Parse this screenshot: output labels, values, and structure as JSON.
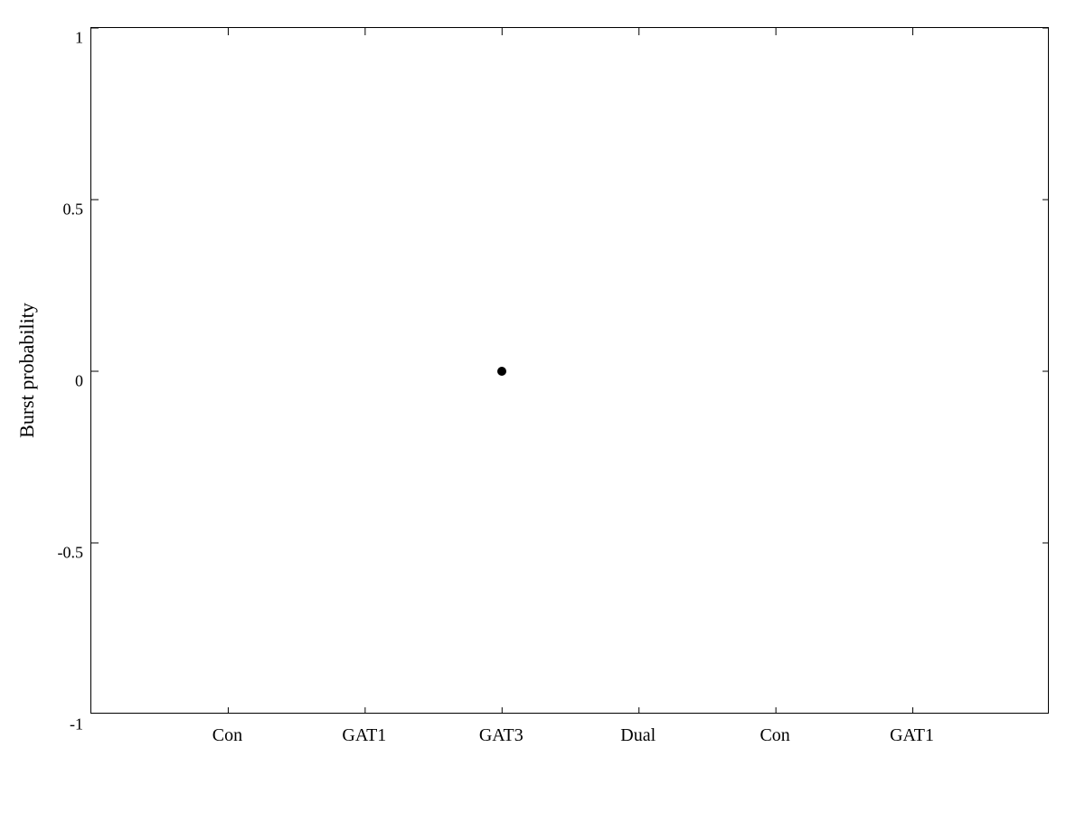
{
  "chart": {
    "title": "",
    "y_axis_label": "Burst probability",
    "x_axis_label": "",
    "y_min": -1,
    "y_max": 1,
    "y_ticks": [
      1,
      0.5,
      0,
      -0.5,
      -1
    ],
    "x_ticks": [
      "Con",
      "GAT1",
      "GAT3",
      "Dual",
      "Con",
      "GAT1"
    ],
    "data_points": [
      {
        "x_index": 2,
        "y_value": 0.0,
        "label": "GAT3"
      }
    ]
  }
}
